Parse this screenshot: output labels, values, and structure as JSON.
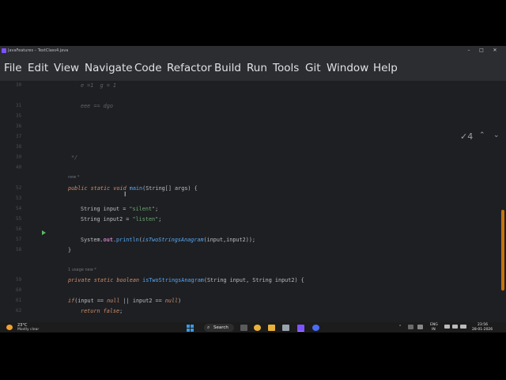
{
  "window": {
    "title": "JavaFeatures – TextClass4.java",
    "minimize_glyph": "–",
    "maximize_glyph": "□",
    "close_glyph": "✕"
  },
  "menu": [
    "File",
    "Edit",
    "View",
    "Navigate",
    "Code",
    "Refactor",
    "Build",
    "Run",
    "Tools",
    "Git",
    "Window",
    "Help"
  ],
  "editor": {
    "inspection_glyph": "✓",
    "inspection_count": "4",
    "nav_up": "⌃",
    "nav_down": "⌄",
    "gutter": [
      "30",
      "31",
      "35",
      "36",
      "37",
      "38",
      "39",
      "40",
      "",
      "52",
      "53",
      "54",
      "55",
      "56",
      "57",
      "58",
      "",
      "59",
      "60",
      "61",
      "62"
    ],
    "lines": {
      "l30": "e =1  g = 1",
      "l31": "eee == dgo",
      "l40": "*/",
      "hint_main": "new *",
      "main_kw1": "public static void ",
      "main_name": "main",
      "main_rest": "(String[] args) {",
      "s1_type": "String input = ",
      "s1_str": "\"silent\"",
      "s1_end": ";",
      "s2_type": "String input2 = ",
      "s2_str": "\"listen\"",
      "s2_end": ";",
      "p_sys": "System.",
      "p_out": "out",
      "p_dot": ".",
      "p_println": "println",
      "p_open": "(",
      "p_call": "isTwoStringsAnagram",
      "p_args": "(input,input2));",
      "close1": "}",
      "hint_method": "1 usage   new *",
      "m_kw": "private static boolean ",
      "m_name": "isTwoStringsAnagram",
      "m_rest": "(String input, String input2) {",
      "if_kw": "if",
      "if_a": "(input == ",
      "if_null1": "null",
      "if_b": " || input2 == ",
      "if_null2": "null",
      "if_c": ")",
      "ret_kw": "return false",
      "ret_end": ";"
    }
  },
  "taskbar": {
    "weather_temp": "23°C",
    "weather_desc": "Mostly clear",
    "search_label": "Search",
    "search_icon": "⌕",
    "tray_up": "⌃",
    "lang_line1": "ENG",
    "lang_line2": "IN",
    "time": "23:56",
    "date": "28-01-2026"
  },
  "colors": {
    "accent_scrollbar": "#c5740f",
    "editor_bg": "#1e1f22",
    "chrome_bg": "#2b2d30"
  }
}
